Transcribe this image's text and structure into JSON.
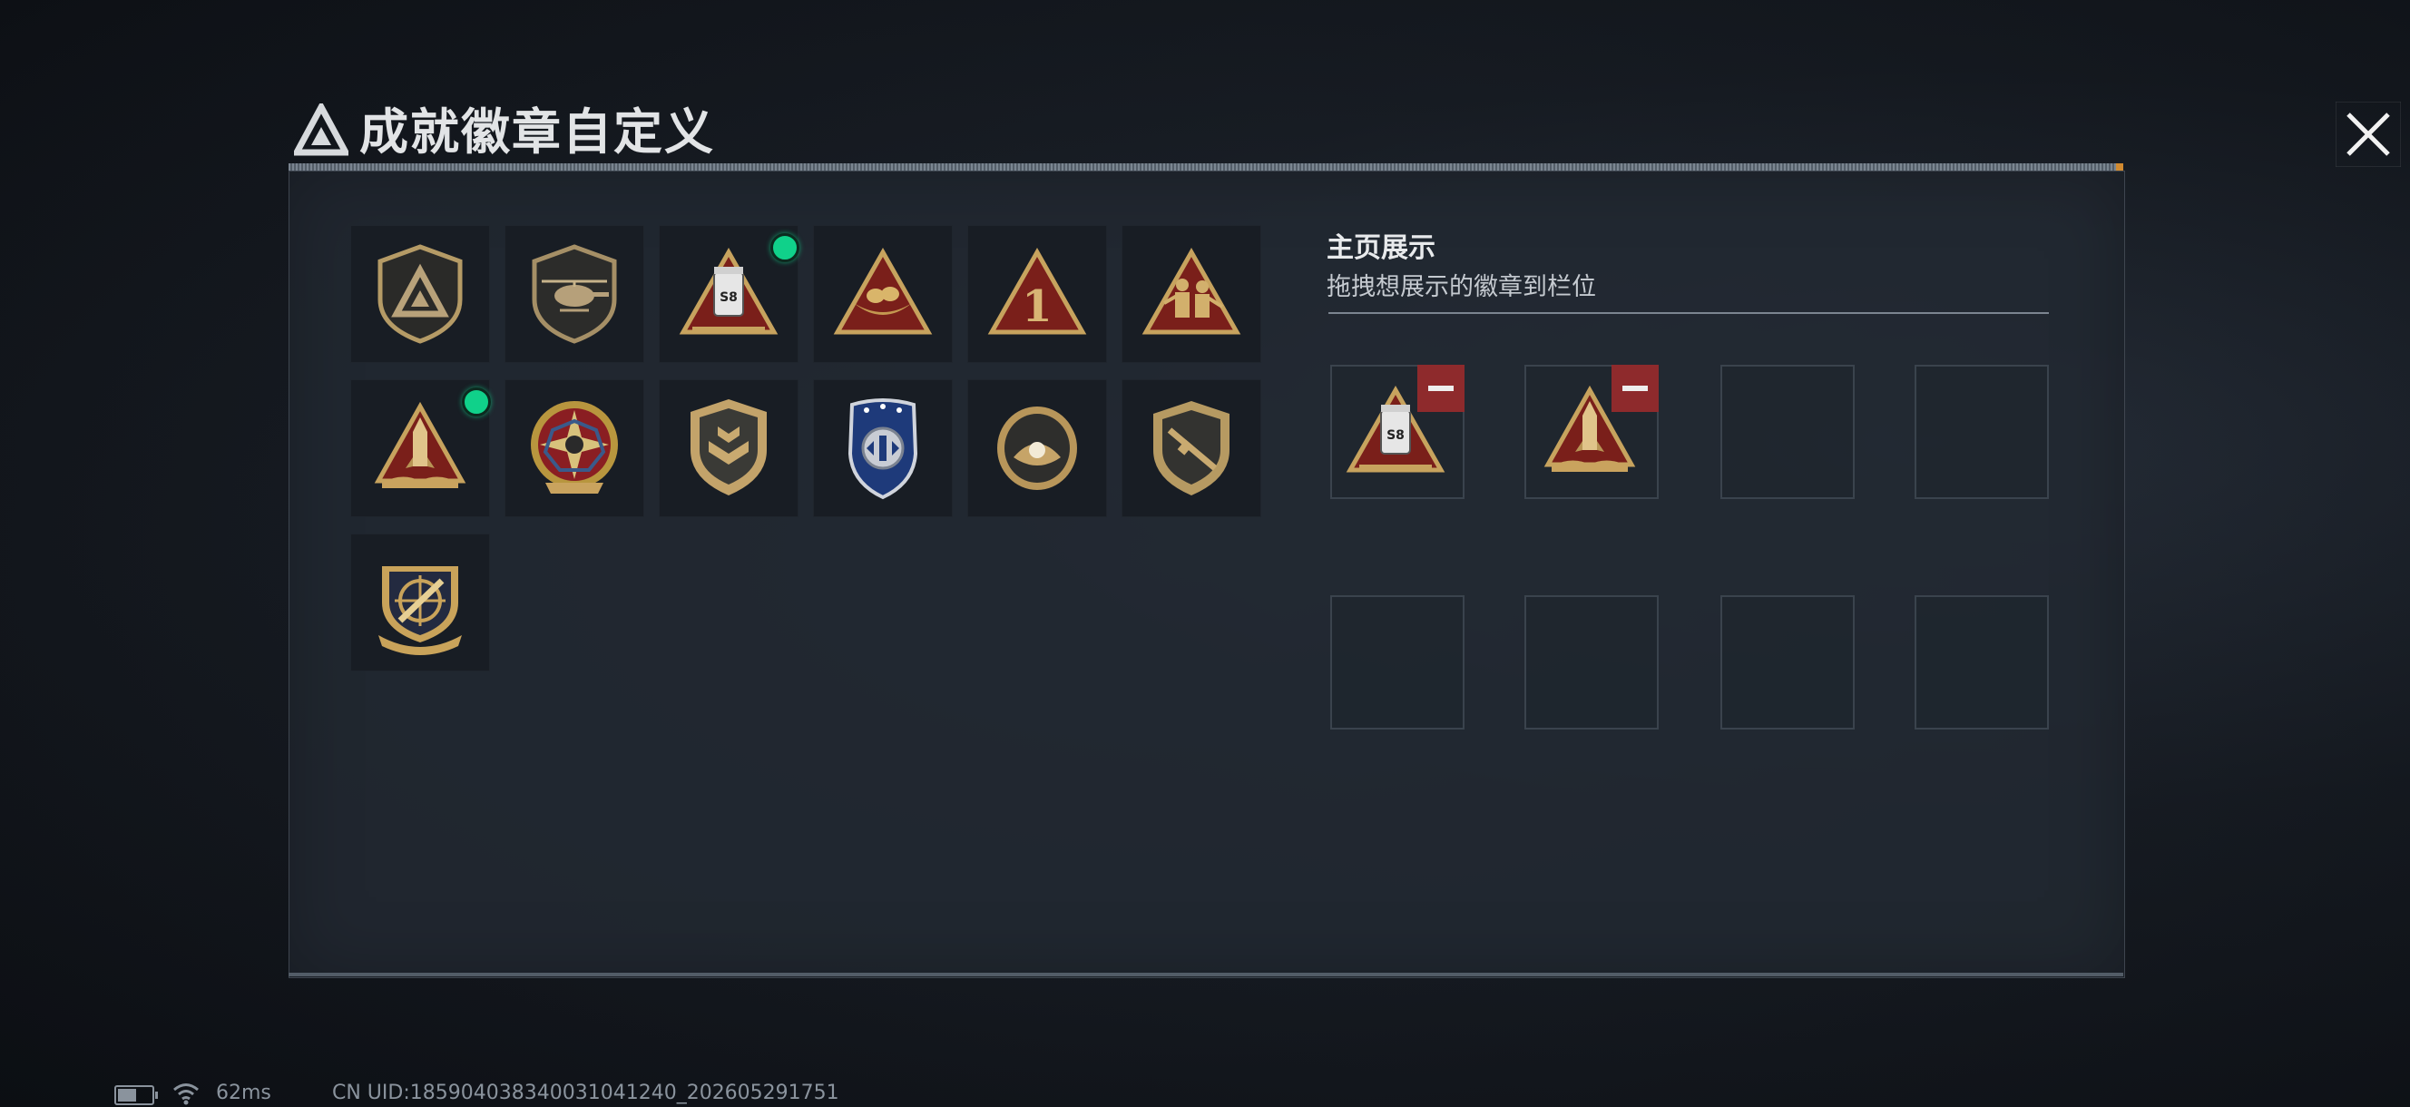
{
  "header": {
    "title": "成就徽章自定义",
    "close_icon": "close-x-icon",
    "logo_icon": "delta-triangle-logo"
  },
  "badges": [
    {
      "icon": "delta-logo-shield-badge",
      "new": false
    },
    {
      "icon": "helicopter-shield-badge",
      "new": false
    },
    {
      "icon": "s8-triangle-badge",
      "new": true
    },
    {
      "icon": "nest-eggs-triangle-badge",
      "new": false
    },
    {
      "icon": "number-one-triangle-badge",
      "new": false
    },
    {
      "icon": "soldiers-triangle-badge",
      "new": false
    },
    {
      "icon": "rocket-triangle-badge",
      "new": true
    },
    {
      "icon": "compass-star-medal-badge",
      "new": false
    },
    {
      "icon": "chevron-shield-badge",
      "new": false
    },
    {
      "icon": "blue-police-shield-badge",
      "new": false
    },
    {
      "icon": "pearl-oval-badge",
      "new": false
    },
    {
      "icon": "rifle-shield-badge",
      "new": false
    },
    {
      "icon": "crosshair-missile-crest-badge",
      "new": false
    }
  ],
  "showcase": {
    "title": "主页展示",
    "subtitle": "拖拽想展示的徽章到栏位",
    "slots": [
      {
        "badge": "s8-triangle-badge"
      },
      {
        "badge": "rocket-triangle-badge"
      },
      {
        "badge": ""
      },
      {
        "badge": ""
      },
      {
        "badge": ""
      },
      {
        "badge": ""
      },
      {
        "badge": ""
      },
      {
        "badge": ""
      }
    ]
  },
  "status": {
    "battery_level": 0.55,
    "ping": "62ms",
    "uid": "CN UID:185904038340031041240_202605291751"
  },
  "colors": {
    "accent_gold": "#c9a868",
    "new_dot": "#10d18a",
    "remove_red": "#8e2a2c"
  }
}
